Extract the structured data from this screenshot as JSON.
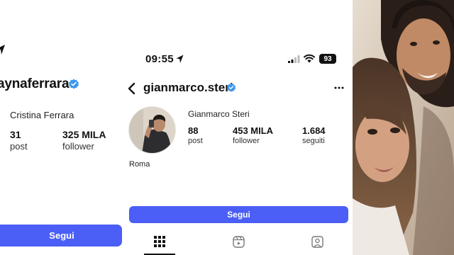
{
  "left_profile": {
    "username": "aynaferrara",
    "full_name": "Cristina Ferrara",
    "posts_count": "31",
    "posts_label": "post",
    "followers_count": "325 MILA",
    "followers_label": "follower",
    "follow_button": "Segui"
  },
  "center_profile": {
    "status_bar": {
      "time": "09:55",
      "battery": "93"
    },
    "username": "gianmarco.steri",
    "full_name": "Gianmarco Steri",
    "posts_count": "88",
    "posts_label": "post",
    "followers_count": "453 MILA",
    "followers_label": "follower",
    "following_count": "1.684",
    "following_label": "seguiti",
    "bio_location": "Roma",
    "follow_button": "Segui",
    "tabs": [
      "grid-icon",
      "reels-icon",
      "tagged-icon"
    ]
  },
  "colors": {
    "accent": "#4b5ef5",
    "verified": "#3b97f0"
  }
}
